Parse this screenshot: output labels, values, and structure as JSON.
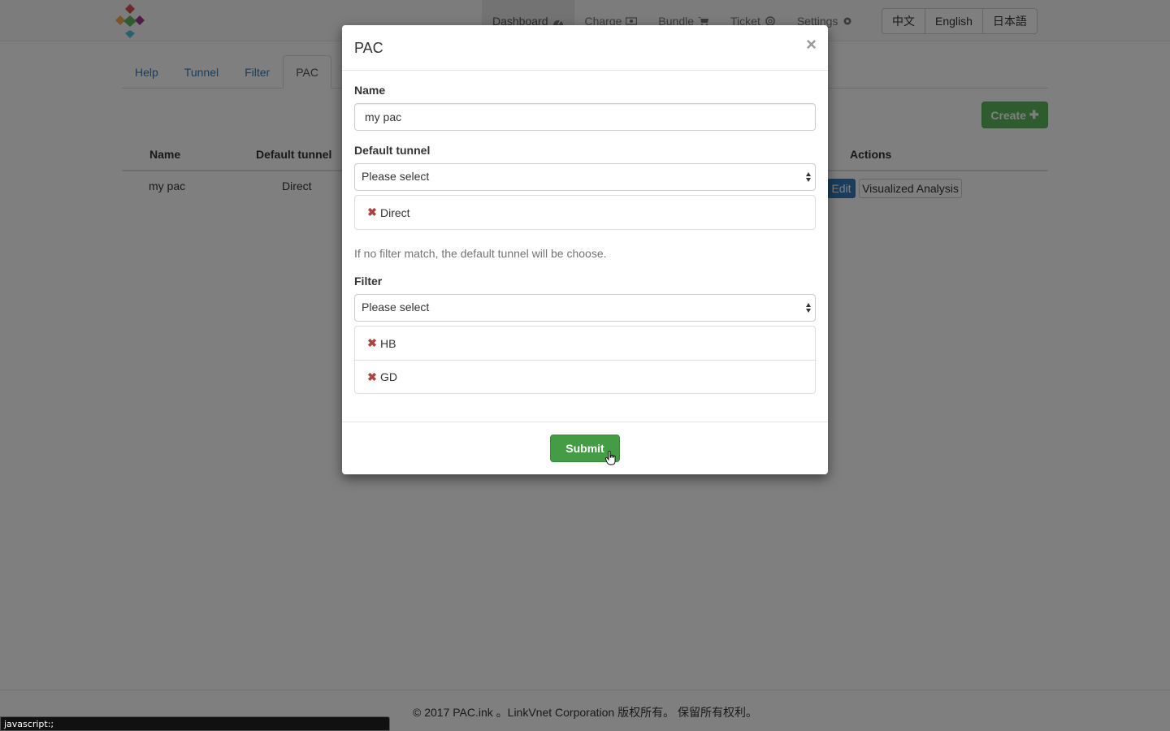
{
  "navbar": {
    "links": [
      {
        "label": "Dashboard",
        "icon": "dashboard-icon"
      },
      {
        "label": "Charge",
        "icon": "money-icon"
      },
      {
        "label": "Bundle",
        "icon": "cart-icon"
      },
      {
        "label": "Ticket",
        "icon": "lifebuoy-icon"
      },
      {
        "label": "Settings",
        "icon": "gear-icon"
      }
    ],
    "languages": [
      "中文",
      "English",
      "日本語"
    ]
  },
  "tabs": [
    "Help",
    "Tunnel",
    "Filter",
    "PAC"
  ],
  "create_button": "Create",
  "table": {
    "headers": {
      "name": "Name",
      "default_tunnel": "Default tunnel",
      "actions": "Actions"
    },
    "rows": [
      {
        "name": "my pac",
        "default_tunnel": "Direct",
        "edit": "Edit",
        "visualized": "Visualized Analysis"
      }
    ]
  },
  "footer": {
    "text": "© 2017 PAC.ink 。LinkVnet Corporation 版权所有。 保留所有权利。"
  },
  "statusbar": {
    "text": "javascript:;"
  },
  "modal": {
    "title": "PAC",
    "close": "×",
    "name_label": "Name",
    "name_value": "my pac",
    "default_tunnel_label": "Default tunnel",
    "default_tunnel_select": "Please select",
    "default_tunnel_items": [
      "Direct"
    ],
    "help_text": "If no filter match, the default tunnel will be choose.",
    "filter_label": "Filter",
    "filter_select": "Please select",
    "filter_items": [
      "HB",
      "GD"
    ],
    "submit": "Submit"
  },
  "colors": {
    "primary": "#337ab7",
    "success": "#5cb85c",
    "danger": "#a94442"
  }
}
